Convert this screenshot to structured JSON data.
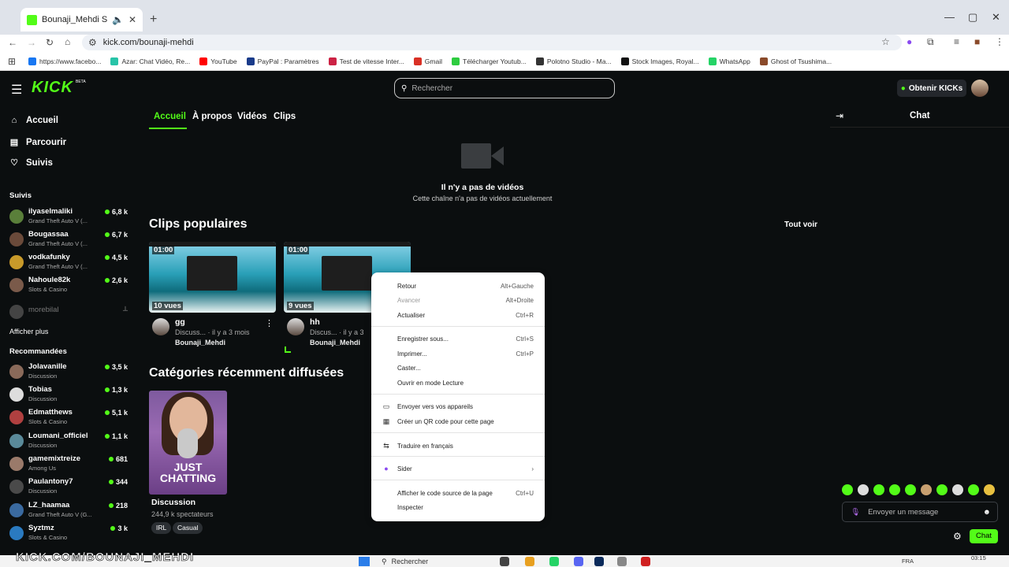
{
  "browser": {
    "tab_title": "Bounaji_Mehdi Stream - W",
    "url": "kick.com/bounaji-mehdi",
    "bookmarks": [
      {
        "label": "https://www.facebo...",
        "color": "#1877f2"
      },
      {
        "label": "Azar: Chat Vidéo, Re...",
        "color": "#27c4a8"
      },
      {
        "label": "YouTube",
        "color": "#ff0000"
      },
      {
        "label": "PayPal : Paramètres",
        "color": "#1a3b8a"
      },
      {
        "label": "Test de vitesse Inter...",
        "color": "#cc2244"
      },
      {
        "label": "Gmail",
        "color": "#d93025"
      },
      {
        "label": "Télécharger Youtub...",
        "color": "#2ecc40"
      },
      {
        "label": "Polotno Studio - Ma...",
        "color": "#333333"
      },
      {
        "label": "Stock Images, Royal...",
        "color": "#111111"
      },
      {
        "label": "WhatsApp",
        "color": "#25d366"
      },
      {
        "label": "Ghost of Tsushima...",
        "color": "#8a4a2a"
      }
    ]
  },
  "header": {
    "logo": "KICK",
    "beta": "BETA",
    "search_placeholder": "Rechercher",
    "kicks_button": "Obtenir KICKs"
  },
  "sidebar": {
    "nav": [
      "Accueil",
      "Parcourir",
      "Suivis"
    ],
    "followed_heading": "Suivis",
    "followed": [
      {
        "name": "ilyaselmaliki",
        "category": "Grand Theft Auto V (...",
        "viewers": "6,8 k",
        "color": "#5a7f3a"
      },
      {
        "name": "Bougassaa",
        "category": "Grand Theft Auto V (...",
        "viewers": "6,7 k",
        "color": "#6a4a3a"
      },
      {
        "name": "vodkafunky",
        "category": "Grand Theft Auto V (...",
        "viewers": "4,5 k",
        "color": "#c89a2a"
      },
      {
        "name": "Nahoule82k",
        "category": "Slots & Casino",
        "viewers": "2,6 k",
        "color": "#7a5a4a"
      }
    ],
    "offline": {
      "name": "morebilal"
    },
    "show_more": "Afficher plus",
    "recommended_heading": "Recommandées",
    "recommended": [
      {
        "name": "Jolavanille",
        "category": "Discussion",
        "viewers": "3,5 k",
        "color": "#8a6a5a"
      },
      {
        "name": "Tobias",
        "category": "Discussion",
        "viewers": "1,3 k",
        "color": "#dddddd"
      },
      {
        "name": "Edmatthews",
        "category": "Slots & Casino",
        "viewers": "5,1 k",
        "color": "#b04040"
      },
      {
        "name": "Loumani_officiel",
        "category": "Discussion",
        "viewers": "1,1 k",
        "color": "#5a8a9a"
      },
      {
        "name": "gamemixtreize",
        "category": "Among Us",
        "viewers": "681",
        "color": "#9a7a6a"
      },
      {
        "name": "Paulantony7",
        "category": "Discussion",
        "viewers": "344",
        "color": "#4a4a4a"
      },
      {
        "name": "LZ_haamaa",
        "category": "Grand Theft Auto V (G...",
        "viewers": "218",
        "color": "#3a6aa0"
      },
      {
        "name": "Syztmz",
        "category": "Slots & Casino",
        "viewers": "3 k",
        "color": "#2a7ac0"
      }
    ]
  },
  "tabs": [
    "Accueil",
    "À propos",
    "Vidéos",
    "Clips"
  ],
  "empty_videos": {
    "title": "Il n'y a pas de vidéos",
    "subtitle": "Cette chaîne n'a pas de vidéos actuellement"
  },
  "clips": {
    "heading": "Clips populaires",
    "see_all": "Tout voir",
    "items": [
      {
        "duration": "01:00",
        "views": "10 vues",
        "title": "gg",
        "meta": "Discuss... · il y a 3 mois",
        "author": "Bounaji_Mehdi"
      },
      {
        "duration": "01:00",
        "views": "9 vues",
        "title": "hh",
        "meta": "Discus... · il y a 3",
        "author": "Bounaji_Mehdi"
      }
    ]
  },
  "categories": {
    "heading": "Catégories récemment diffusées",
    "card_text": "JUST CHATTING",
    "name": "Discussion",
    "viewers": "244,9 k spectateurs",
    "tags": [
      "IRL",
      "Casual"
    ]
  },
  "context_menu": [
    {
      "label": "Retour",
      "shortcut": "Alt+Gauche"
    },
    {
      "label": "Avancer",
      "shortcut": "Alt+Droite",
      "disabled": true
    },
    {
      "label": "Actualiser",
      "shortcut": "Ctrl+R"
    },
    {
      "label": "Enregistrer sous...",
      "shortcut": "Ctrl+S"
    },
    {
      "label": "Imprimer...",
      "shortcut": "Ctrl+P"
    },
    {
      "label": "Caster...",
      "shortcut": ""
    },
    {
      "label": "Ouvrir en mode Lecture",
      "shortcut": ""
    },
    {
      "label": "Envoyer vers vos appareils",
      "shortcut": "",
      "icon": "▭"
    },
    {
      "label": "Créer un QR code pour cette page",
      "shortcut": "",
      "icon": "▦"
    },
    {
      "label": "Traduire en français",
      "shortcut": "",
      "icon": "⇆"
    },
    {
      "label": "Sider",
      "shortcut": "›",
      "icon": "●"
    },
    {
      "label": "Afficher le code source de la page",
      "shortcut": "Ctrl+U"
    },
    {
      "label": "Inspecter",
      "shortcut": ""
    }
  ],
  "chat": {
    "title": "Chat",
    "input_placeholder": "Envoyer un message",
    "button": "Chat"
  },
  "overlay": {
    "watermark": "KICK.COM/BOUNAJI_MEHDI"
  },
  "taskbar": {
    "search": "Rechercher",
    "lang": "FRA",
    "time": "03:15"
  },
  "colors": {
    "accent": "#53fc18",
    "background": "#0b0e0f"
  }
}
